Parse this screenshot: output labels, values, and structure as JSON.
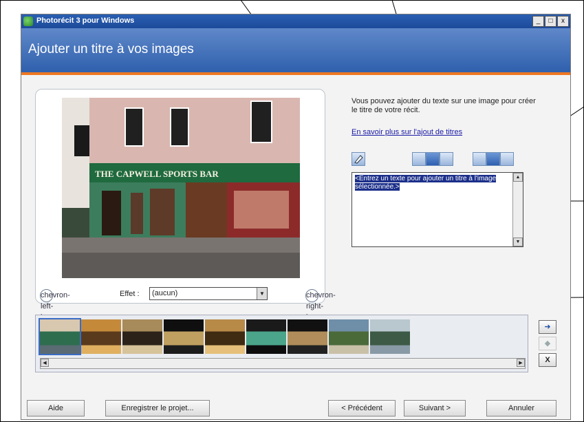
{
  "window": {
    "title": "Photorécit 3 pour Windows",
    "controls": {
      "minimize": "_",
      "maximize": "□",
      "close": "x"
    }
  },
  "header": {
    "title": "Ajouter un titre à vos images",
    "accent_color": "#ee7722"
  },
  "preview": {
    "photo_sign": "THE CAPWELL SPORTS BAR",
    "effect_label": "Effet :",
    "effect_value": "(aucun)",
    "prev_icon": "chevron-left-icon",
    "next_icon": "chevron-right-icon"
  },
  "panel": {
    "info_text": "Vous pouvez ajouter du texte sur une image pour créer le titre de votre récit.",
    "link_text": "En savoir plus sur l'ajout de titres",
    "textbox_text": "<Entrez un texte pour ajouter un titre à l'image sélectionnée.>"
  },
  "filmstrip": {
    "thumbnails": [
      {
        "colors": [
          "#d9c8b0",
          "#2f6d4f",
          "#5a6b73"
        ]
      },
      {
        "colors": [
          "#c48a3a",
          "#5a3a1c",
          "#e0b060"
        ]
      },
      {
        "colors": [
          "#a88b5a",
          "#2b231a",
          "#d6c39a"
        ]
      },
      {
        "colors": [
          "#0f0f0f",
          "#c0a060",
          "#1c1c1c"
        ]
      },
      {
        "colors": [
          "#b78a48",
          "#3f2a12",
          "#e6c07a"
        ]
      },
      {
        "colors": [
          "#1a1a1a",
          "#4aa58a",
          "#0d0d0d"
        ]
      },
      {
        "colors": [
          "#111111",
          "#b08d5b",
          "#222222"
        ]
      },
      {
        "colors": [
          "#6f8fa8",
          "#4b6a3a",
          "#c9c0a8"
        ]
      },
      {
        "colors": [
          "#b9c7cf",
          "#3c5a45",
          "#889aa5"
        ]
      }
    ],
    "side_buttons": {
      "add": "➜",
      "move": "◆",
      "remove": "X"
    }
  },
  "buttons": {
    "help": "Aide",
    "save": "Enregistrer le projet...",
    "back": "< Précédent",
    "next": "Suivant >",
    "cancel": "Annuler"
  }
}
